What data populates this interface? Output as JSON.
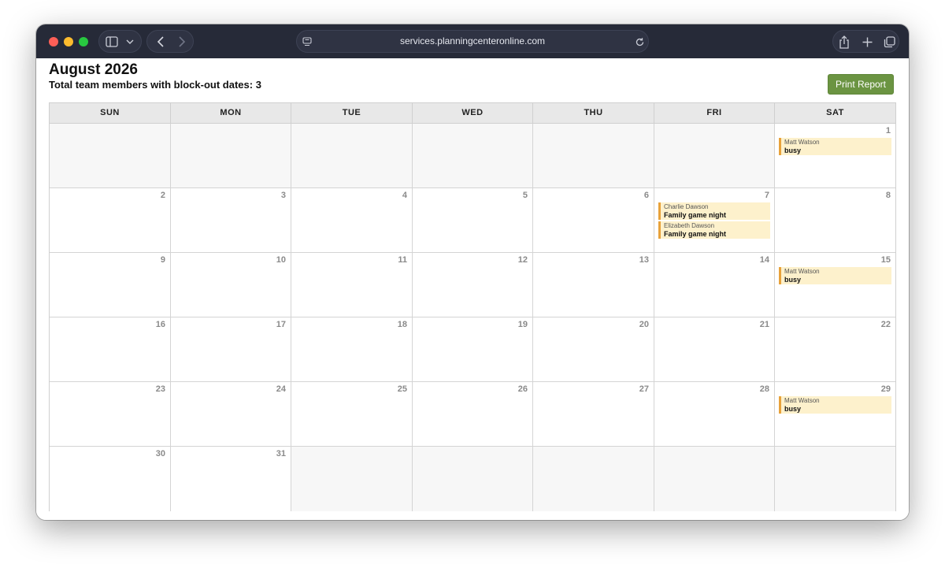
{
  "browser": {
    "url": "services.planningcenteronline.com"
  },
  "header": {
    "month_title": "August 2026",
    "subtitle": "Total team members with block-out dates: 3",
    "print_label": "Print Report"
  },
  "calendar": {
    "days_of_week": [
      "SUN",
      "MON",
      "TUE",
      "WED",
      "THU",
      "FRI",
      "SAT"
    ],
    "weeks": [
      [
        {
          "num": "",
          "events": []
        },
        {
          "num": "",
          "events": []
        },
        {
          "num": "",
          "events": []
        },
        {
          "num": "",
          "events": []
        },
        {
          "num": "",
          "events": []
        },
        {
          "num": "",
          "events": []
        },
        {
          "num": "1",
          "events": [
            {
              "name": "Matt Watson",
              "reason": "busy"
            }
          ]
        }
      ],
      [
        {
          "num": "2",
          "events": []
        },
        {
          "num": "3",
          "events": []
        },
        {
          "num": "4",
          "events": []
        },
        {
          "num": "5",
          "events": []
        },
        {
          "num": "6",
          "events": []
        },
        {
          "num": "7",
          "events": [
            {
              "name": "Charlie Dawson",
              "reason": "Family game night"
            },
            {
              "name": "Elizabeth Dawson",
              "reason": "Family game night"
            }
          ]
        },
        {
          "num": "8",
          "events": []
        }
      ],
      [
        {
          "num": "9",
          "events": []
        },
        {
          "num": "10",
          "events": []
        },
        {
          "num": "11",
          "events": []
        },
        {
          "num": "12",
          "events": []
        },
        {
          "num": "13",
          "events": []
        },
        {
          "num": "14",
          "events": []
        },
        {
          "num": "15",
          "events": [
            {
              "name": "Matt Watson",
              "reason": "busy"
            }
          ]
        }
      ],
      [
        {
          "num": "16",
          "events": []
        },
        {
          "num": "17",
          "events": []
        },
        {
          "num": "18",
          "events": []
        },
        {
          "num": "19",
          "events": []
        },
        {
          "num": "20",
          "events": []
        },
        {
          "num": "21",
          "events": []
        },
        {
          "num": "22",
          "events": []
        }
      ],
      [
        {
          "num": "23",
          "events": []
        },
        {
          "num": "24",
          "events": []
        },
        {
          "num": "25",
          "events": []
        },
        {
          "num": "26",
          "events": []
        },
        {
          "num": "27",
          "events": []
        },
        {
          "num": "28",
          "events": []
        },
        {
          "num": "29",
          "events": [
            {
              "name": "Matt Watson",
              "reason": "busy"
            }
          ]
        }
      ],
      [
        {
          "num": "30",
          "events": []
        },
        {
          "num": "31",
          "events": []
        },
        {
          "num": "",
          "events": []
        },
        {
          "num": "",
          "events": []
        },
        {
          "num": "",
          "events": []
        },
        {
          "num": "",
          "events": []
        },
        {
          "num": "",
          "events": []
        }
      ]
    ]
  },
  "colors": {
    "print_button": "#6b9442",
    "event_background": "#fdf1cc",
    "event_accent": "#e8a23a",
    "titlebar": "#262a38"
  }
}
